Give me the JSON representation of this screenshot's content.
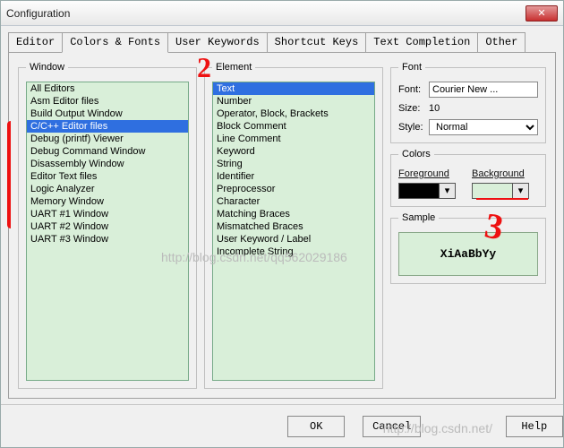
{
  "window_title": "Configuration",
  "tabs": [
    {
      "label": "Editor"
    },
    {
      "label": "Colors & Fonts"
    },
    {
      "label": "User Keywords"
    },
    {
      "label": "Shortcut Keys"
    },
    {
      "label": "Text Completion"
    },
    {
      "label": "Other"
    }
  ],
  "active_tab_index": 1,
  "groupbox": {
    "window": "Window",
    "element": "Element",
    "font": "Font",
    "colors": "Colors",
    "sample": "Sample"
  },
  "window_list": {
    "items": [
      "All Editors",
      "Asm Editor files",
      "Build Output Window",
      "C/C++ Editor files",
      "Debug (printf) Viewer",
      "Debug Command Window",
      "Disassembly Window",
      "Editor Text files",
      "Logic Analyzer",
      "Memory Window",
      "UART #1 Window",
      "UART #2 Window",
      "UART #3 Window"
    ],
    "selected_index": 3
  },
  "element_list": {
    "items": [
      "Text",
      "Number",
      "Operator, Block, Brackets",
      "Block Comment",
      "Line Comment",
      "Keyword",
      "String",
      "Identifier",
      "Preprocessor",
      "Character",
      "Matching Braces",
      "Mismatched Braces",
      "User Keyword / Label",
      "Incomplete String"
    ],
    "selected_index": 0
  },
  "font": {
    "label_font": "Font:",
    "value_font": "Courier New ...",
    "label_size": "Size:",
    "value_size": "10",
    "label_style": "Style:",
    "value_style": "Normal"
  },
  "colors": {
    "foreground_label": "Foreground",
    "background_label": "Background",
    "foreground_value": "#000000",
    "background_value": "#d9efd9"
  },
  "sample_text": "XiAaBbYy",
  "buttons": {
    "ok": "OK",
    "cancel": "Cancel",
    "help": "Help"
  },
  "annotations": {
    "two": "2",
    "three": "3"
  },
  "watermarks": {
    "w1": "http://blog.csdn.net/qq562029186",
    "w2": "http://blog.csdn.net/"
  }
}
